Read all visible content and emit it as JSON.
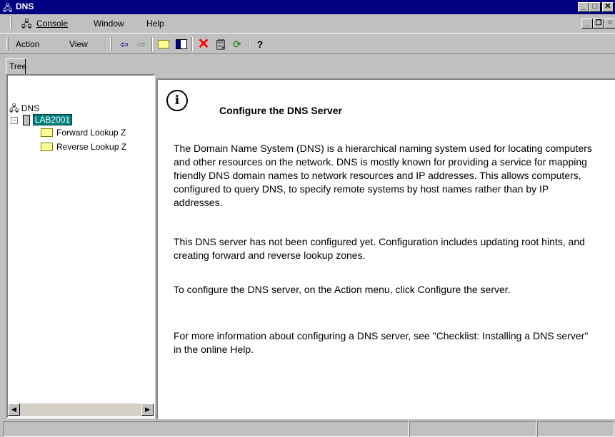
{
  "window": {
    "title": "DNS"
  },
  "menubar": {
    "console_label": "Console",
    "window_label": "Window",
    "help_label": "Help"
  },
  "toolbar": {
    "action_label": "Action",
    "view_label": "View"
  },
  "left_pane": {
    "tab_label": "Tree",
    "tree": {
      "root_label": "DNS",
      "server_label": "LAB2001",
      "children": [
        "Forward Lookup Z",
        "Reverse Lookup Z"
      ]
    }
  },
  "right_pane": {
    "heading": "Configure the DNS Server",
    "paragraph1": "The Domain Name System (DNS) is a hierarchical naming system used for locating computers and other resources on the network. DNS is mostly known for providing a service for mapping friendly DNS domain names to network resources and IP addresses. This allows computers, configured to query DNS, to specify remote systems by host names rather than by IP addresses.",
    "paragraph2": "This DNS server has not been configured yet. Configuration includes updating root hints, and creating forward and reverse lookup zones.",
    "paragraph3": "To configure the DNS server, on the Action menu, click Configure the server.",
    "paragraph4": "For more information about configuring a DNS server, see \"Checklist: Installing a DNS server\" in the online Help."
  },
  "colors": {
    "titlebar": "#000080",
    "selection": "#008080",
    "face": "#c0c0c0"
  }
}
